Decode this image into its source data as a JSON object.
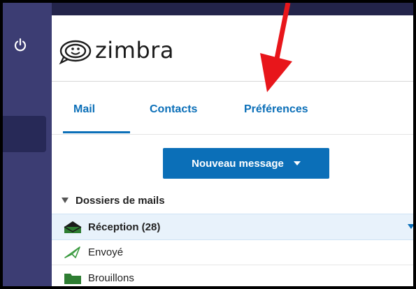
{
  "logo": {
    "text": "zimbra"
  },
  "tabs": [
    {
      "label": "Mail"
    },
    {
      "label": "Contacts"
    },
    {
      "label": "Préférences"
    }
  ],
  "new_message_button": {
    "label": "Nouveau message"
  },
  "folders": {
    "header": "Dossiers de mails",
    "items": [
      {
        "label": "Réception (28)"
      },
      {
        "label": "Envoyé"
      },
      {
        "label": "Brouillons"
      }
    ]
  },
  "colors": {
    "accent": "#0b6fb8",
    "rail": "#3c3d73",
    "annotation": "#e8161b"
  },
  "icons": {
    "rail": "power-icon",
    "logo": "zimbra-logo-icon",
    "inbox": "inbox-envelope-icon",
    "sent": "paper-plane-icon",
    "drafts": "folder-icon"
  }
}
